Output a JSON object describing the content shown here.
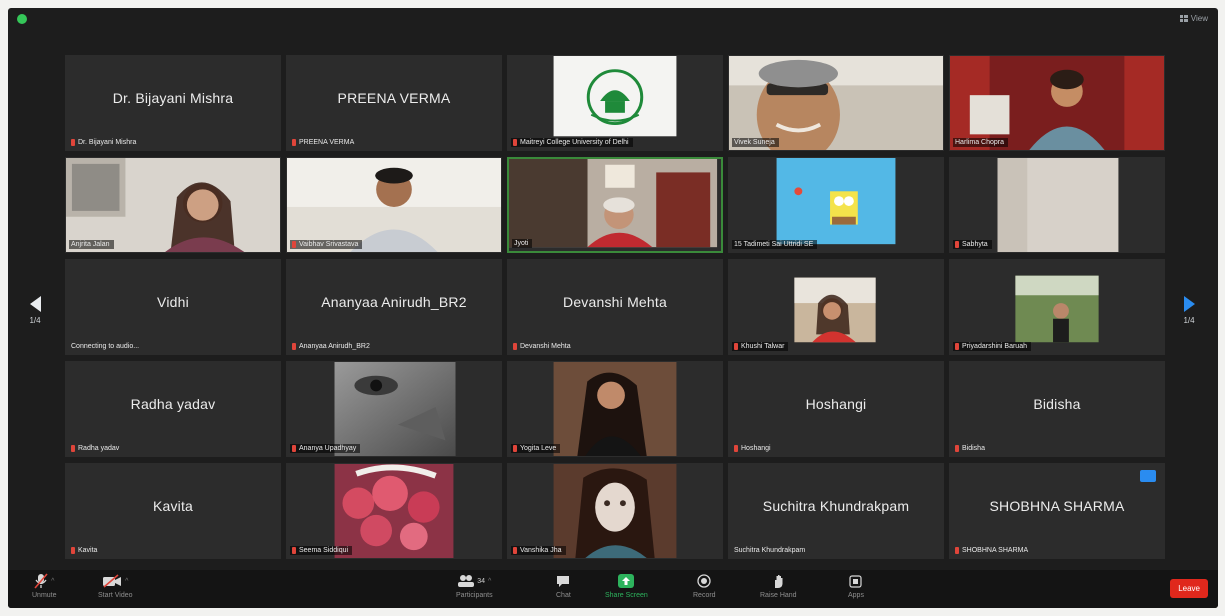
{
  "window": {
    "view_label": "View"
  },
  "navigation": {
    "left_page": "1/4",
    "right_page": "1/4"
  },
  "tiles": [
    {
      "display": "Dr. Bijayani Mishra",
      "label": "Dr. Bijayani Mishra",
      "muted": true,
      "video": false
    },
    {
      "display": "PREENA VERMA",
      "label": "PREENA VERMA",
      "muted": true,
      "video": false
    },
    {
      "display": "",
      "label": "Maitreyi College University of Delhi",
      "muted": true,
      "video": true,
      "scene": "logo"
    },
    {
      "display": "",
      "label": "Vivek Suneja",
      "muted": false,
      "video": true,
      "scene": "man-light"
    },
    {
      "display": "",
      "label": "Harlima Chopra",
      "muted": false,
      "video": true,
      "scene": "woman-curtain"
    },
    {
      "display": "",
      "label": "Anjrita Jalan",
      "muted": false,
      "video": true,
      "scene": "woman-room"
    },
    {
      "display": "",
      "label": "Vaibhav Srivastava",
      "muted": true,
      "video": true,
      "scene": "man-white"
    },
    {
      "display": "",
      "label": "Jyoti",
      "muted": false,
      "video": true,
      "scene": "woman-art",
      "active": true
    },
    {
      "display": "",
      "label": "15 Tadimeti Sai Uttridi SE",
      "muted": false,
      "video": true,
      "scene": "cartoon"
    },
    {
      "display": "",
      "label": "Sabhyta",
      "muted": true,
      "video": true,
      "scene": "wall"
    },
    {
      "display": "Vidhi",
      "label": "Connecting to audio...",
      "muted": false,
      "video": false
    },
    {
      "display": "Ananyaa Anirudh_BR2",
      "label": "Ananyaa Anirudh_BR2",
      "muted": true,
      "video": false
    },
    {
      "display": "Devanshi Mehta",
      "label": "Devanshi Mehta",
      "muted": true,
      "video": false
    },
    {
      "display": "",
      "label": "Khushi Talwar",
      "muted": true,
      "video": true,
      "scene": "photo-girl-red"
    },
    {
      "display": "",
      "label": "Priyadarshini Baruah",
      "muted": true,
      "video": true,
      "scene": "photo-garden"
    },
    {
      "display": "Radha yadav",
      "label": "Radha yadav",
      "muted": true,
      "video": false
    },
    {
      "display": "",
      "label": "Ananya Upadhyay",
      "muted": true,
      "video": true,
      "scene": "photo-eye"
    },
    {
      "display": "",
      "label": "Yogita Leve",
      "muted": true,
      "video": true,
      "scene": "photo-girl-dark"
    },
    {
      "display": "Hoshangi",
      "label": "Hoshangi",
      "muted": true,
      "video": false
    },
    {
      "display": "Bidisha",
      "label": "Bidisha",
      "muted": true,
      "video": false
    },
    {
      "display": "Kavita",
      "label": "Kavita",
      "muted": true,
      "video": false
    },
    {
      "display": "",
      "label": "Seema Siddiqui",
      "muted": true,
      "video": true,
      "scene": "photo-roses"
    },
    {
      "display": "",
      "label": "Vanshika Jha",
      "muted": true,
      "video": true,
      "scene": "photo-girl-mask"
    },
    {
      "display": "Suchitra Khundrakpam",
      "label": "Suchitra Khundrakpam",
      "muted": false,
      "video": false
    },
    {
      "display": "SHOBHNA SHARMA",
      "label": "SHOBHNA SHARMA",
      "muted": true,
      "video": false,
      "badge": true
    }
  ],
  "toolbar": {
    "unmute": "Unmute",
    "start_video": "Start Video",
    "participants": "Participants",
    "participants_count": "34",
    "chat": "Chat",
    "share_screen": "Share Screen",
    "record": "Record",
    "raise_hand": "Raise Hand",
    "apps": "Apps",
    "leave": "Leave"
  },
  "colors": {
    "accent_green": "#2db35d",
    "leave_red": "#e0281c",
    "nav_blue": "#2a8cf0",
    "mute_red": "#e0453a"
  }
}
